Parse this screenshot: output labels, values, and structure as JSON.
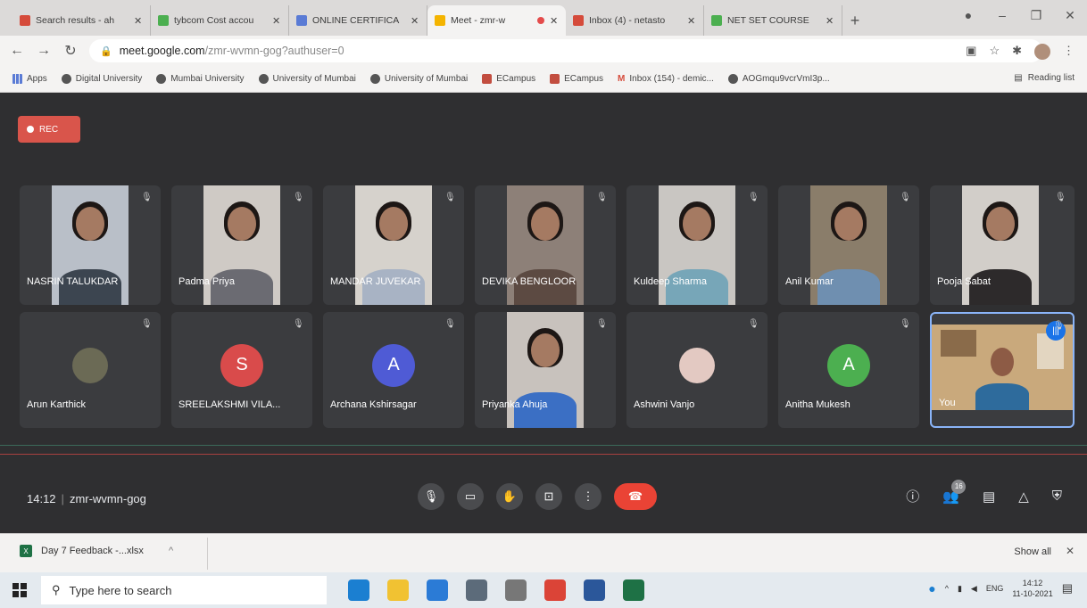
{
  "browser": {
    "tabs": [
      {
        "title": "Search results - ah",
        "favicon_color": "#d54b3b",
        "active": false
      },
      {
        "title": "tybcom Cost accou",
        "favicon_color": "#4caf50",
        "active": false
      },
      {
        "title": "ONLINE CERTIFICA",
        "favicon_color": "#5a7bd5",
        "active": false
      },
      {
        "title": "Meet - zmr-w",
        "favicon_color": "#f4b400",
        "active": true
      },
      {
        "title": "Inbox (4) - netasto",
        "favicon_color": "#d54b3b",
        "active": false
      },
      {
        "title": "NET SET COURSE",
        "favicon_color": "#4caf50",
        "active": false
      }
    ],
    "url_host": "meet.google.com",
    "url_path": "/zmr-wvmn-gog?authuser=0",
    "bookmarks": [
      {
        "label": "Apps",
        "icon": "apps-grid-icon"
      },
      {
        "label": "Digital University",
        "icon": "globe-icon"
      },
      {
        "label": "Mumbai University",
        "icon": "globe-icon"
      },
      {
        "label": "University of Mumbai",
        "icon": "globe-icon"
      },
      {
        "label": "University of Mumbai",
        "icon": "globe-icon"
      },
      {
        "label": "ECampus",
        "icon": "ecampus-icon"
      },
      {
        "label": "ECampus",
        "icon": "ecampus-icon"
      },
      {
        "label": "Inbox (154) - demic...",
        "icon": "gmail-icon"
      },
      {
        "label": "AOGmqu9vcrVmI3p...",
        "icon": "leaf-icon"
      }
    ],
    "reading_list": "Reading list"
  },
  "meet": {
    "rec_label": "REC",
    "participants_row1": [
      {
        "name": "NASRIN TALUKDAR",
        "type": "video",
        "bg": "#b9bfc8",
        "body": "#3c4550"
      },
      {
        "name": "Padma Priya",
        "type": "video",
        "bg": "#cfcac5",
        "body": "#6b6b72"
      },
      {
        "name": "MANDAR JUVEKAR",
        "type": "video",
        "bg": "#d6d2cc",
        "body": "#a8b3c4"
      },
      {
        "name": "DEVIKA BENGLOOR",
        "type": "video",
        "bg": "#8d8078",
        "body": "#5c4a42"
      },
      {
        "name": "Kuldeep Sharma",
        "type": "video",
        "bg": "#c9c6c2",
        "body": "#77a6b8"
      },
      {
        "name": "Anil Kumar",
        "type": "video",
        "bg": "#8a7d6a",
        "body": "#6f8fb0"
      },
      {
        "name": "Pooja Sabat",
        "type": "video",
        "bg": "#d2cec9",
        "body": "#2d2a2b"
      }
    ],
    "participants_row2": [
      {
        "name": "Arun Karthick",
        "type": "photo",
        "color": "#6b6a55"
      },
      {
        "name": "SREELAKSHMI VILA...",
        "type": "initial",
        "initial": "S",
        "color": "#d94b4b"
      },
      {
        "name": "Archana Kshirsagar",
        "type": "initial",
        "initial": "A",
        "color": "#4f5bd5"
      },
      {
        "name": "Priyanka Ahuja",
        "type": "video",
        "bg": "#c8c2bd",
        "body": "#3b6fc4"
      },
      {
        "name": "Ashwini Vanjo",
        "type": "photo",
        "color": "#e3c9c2"
      },
      {
        "name": "Anitha Mukesh",
        "type": "initial",
        "initial": "A",
        "color": "#4caf50"
      },
      {
        "name": "You",
        "type": "self"
      }
    ],
    "time": "14:12",
    "meeting_code": "zmr-wvmn-gog",
    "participant_count": "16"
  },
  "downloads": {
    "file": "Day 7 Feedback -...xlsx",
    "show_all": "Show all"
  },
  "taskbar": {
    "search_placeholder": "Type here to search",
    "lang": "ENG",
    "clock_time": "14:12",
    "clock_date": "11-10-2021"
  }
}
